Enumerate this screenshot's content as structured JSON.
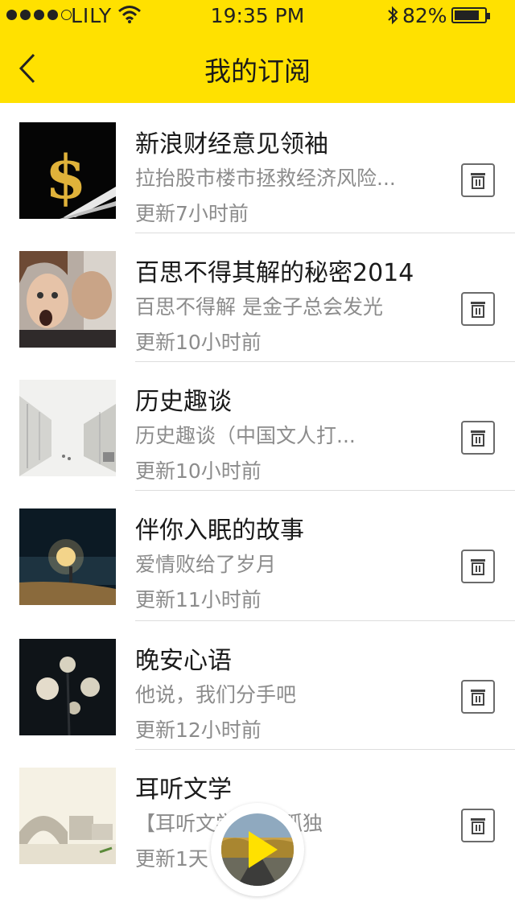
{
  "status_bar": {
    "carrier": "LILY",
    "time": "19:35 PM",
    "battery": "82%"
  },
  "nav": {
    "title": "我的订阅"
  },
  "items": [
    {
      "name": "新浪财经意见领袖",
      "desc": "拉抬股市楼市拯救经济风险...",
      "updated": "更新7小时前",
      "thumb": "dollar-sign-thumbnail"
    },
    {
      "name": "百思不得其解的秘密2014",
      "desc": "百思不得解 是金子总会发光",
      "updated": "更新10小时前",
      "thumb": "whisper-couple-thumbnail"
    },
    {
      "name": "历史趣谈",
      "desc": "历史趣谈（中国文人打...",
      "updated": "更新10小时前",
      "thumb": "old-street-sketch-thumbnail"
    },
    {
      "name": "伴你入眠的故事",
      "desc": "爱情败给了岁月",
      "updated": "更新11小时前",
      "thumb": "lantern-night-sea-thumbnail"
    },
    {
      "name": "晚安心语",
      "desc": "他说，我们分手吧",
      "updated": "更新12小时前",
      "thumb": "night-lamps-thumbnail"
    },
    {
      "name": "耳听文学",
      "desc": "【耳听文学】旅 孤独",
      "updated": "更新1天",
      "thumb": "stone-bridge-painting-thumbnail"
    }
  ],
  "player": {
    "icon": "play-icon",
    "cover": "road-landscape-cover"
  },
  "colors": {
    "accent": "#ffe100",
    "text": "#1a1a1a",
    "muted": "#8c8c8c",
    "divider": "#dddddd"
  }
}
